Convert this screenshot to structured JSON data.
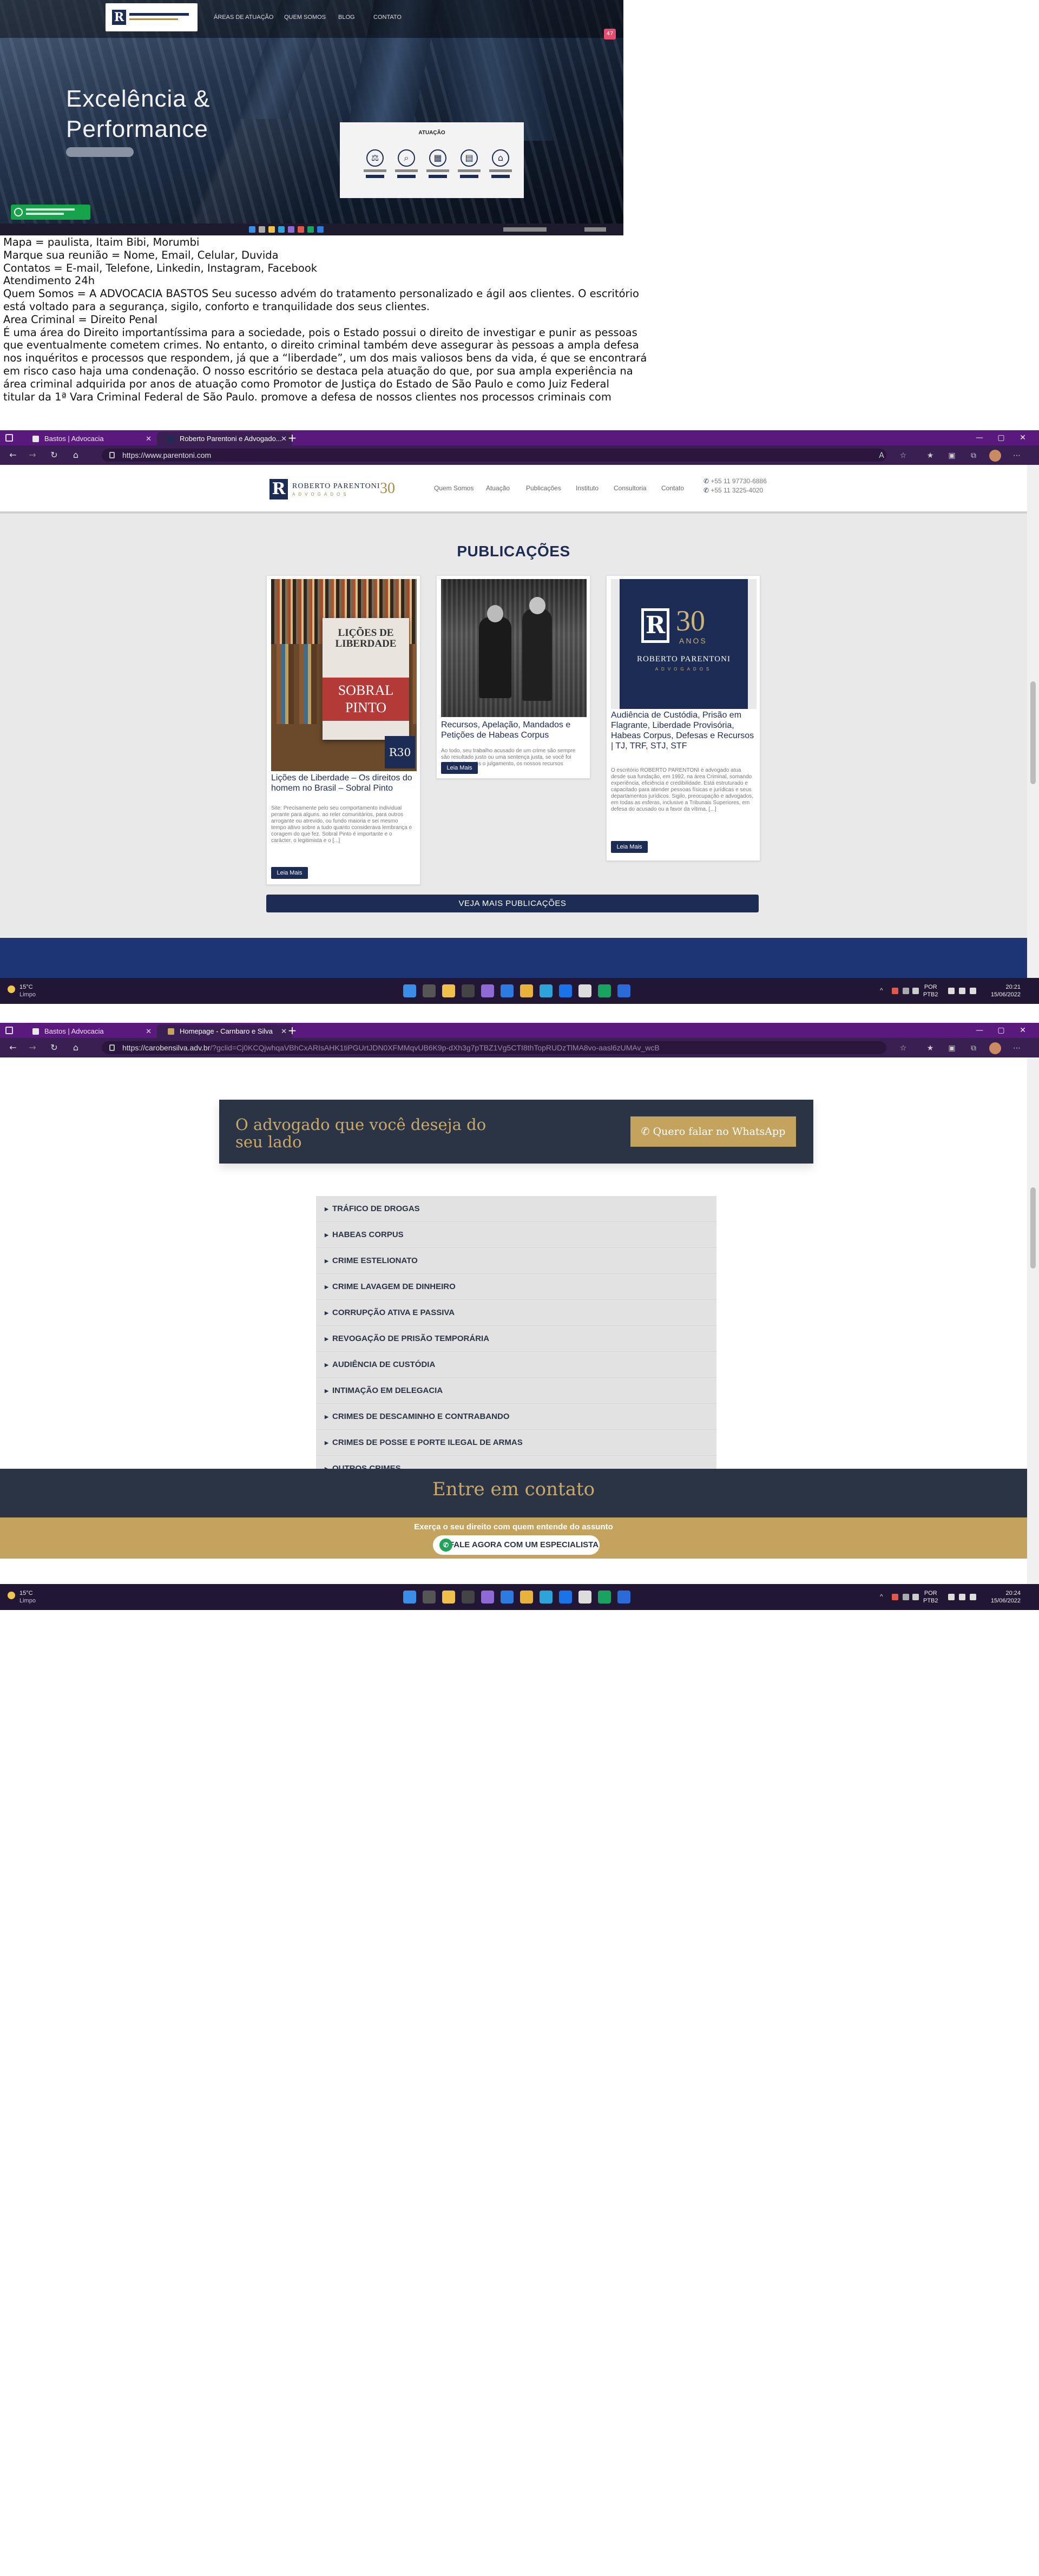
{
  "landing": {
    "nav": [
      "ÁREAS DE ATUAÇÃO",
      "QUEM SOMOS",
      "BLOG",
      "CONTATO"
    ],
    "hero_line1": "Excelência &",
    "hero_line2": "Performance",
    "atuacao_title": "ATUAÇÃO",
    "badge": "47"
  },
  "notes": [
    "Mapa = paulista, Itaim Bibi, Morumbi",
    "Marque sua reunião = Nome, Email, Celular, Duvida",
    "Contatos = E-mail, Telefone, Linkedin, Instagram, Facebook",
    "Atendimento 24h",
    "Quem Somos = A ADVOCACIA BASTOS Seu sucesso advém do tratamento personalizado e ágil aos clientes. O escritório",
    "está voltado para a segurança, sigilo, conforto e tranquilidade dos seus clientes.",
    "Area Criminal = Direito Penal",
    "É uma área do Direito importantíssima para a sociedade, pois o Estado possui o direito de investigar e punir as pessoas",
    "que eventualmente cometem crimes. No entanto, o direito criminal também deve assegurar às pessoas a ampla defesa",
    "nos inquéritos e processos que respondem, já que a “liberdade”, um dos mais valiosos bens da vida, é que se encontrará",
    "em risco caso haja uma condenação. O nosso escritório se destaca pela atuação do que, por sua ampla experiência na",
    "área criminal adquirida por anos de atuação como Promotor de Justiça do Estado de São Paulo e como Juiz Federal",
    "titular da 1ª Vara Criminal Federal de São Paulo. promove a defesa de nossos clientes nos processos criminais com"
  ],
  "window1": {
    "tabs": [
      "Bastos | Advocacia",
      "Roberto Parentoni e Advogado..."
    ],
    "url": "https://www.parentoni.com",
    "logo_name": "ROBERTO PARENTONI",
    "logo_sub": "ADVOGADOS",
    "logo_years": "30",
    "menu": [
      "Quem Somos",
      "Atuação",
      "Publicações",
      "Instituto",
      "Consultoria",
      "Contato"
    ],
    "phone1": "+55 11 97730-6886",
    "phone2": "+55 11 3225-4020",
    "section_title": "PUBLICAÇÕES",
    "cards": [
      {
        "title": "Lições de Liberdade – Os direitos do homem no Brasil – Sobral Pinto",
        "excerpt": "Site: Precisamente pelo seu comportamento individual perante para alguns. ao reler comunitários, para outros arrogante ou atrevido, ou fundo maioria e sei mesmo tempo altivo sobre a tudo quanto considerava lembrança e coragem do que fez. Sobral Pinto é importante e o carácter, o legitimista e o [...]",
        "read_more": "Leia Mais",
        "book_line1": "LIÇÕES DE",
        "book_line2": "LIBERDADE",
        "book_name": "SOBRAL PINTO"
      },
      {
        "title": "Recursos, Apelação, Mandados e Petições de Habeas Corpus",
        "excerpt": "Ao todo, seu trabalho acusado de um crime são sempre são resultado justo ou uma sentença justa, se você foi condenado após o julgamento, os nossos recursos criminais, embora tenha sido no pior cenário seu histórico de vida, ainda há uma chance de obter um resultado melhor. Se o caso de tribunal [...]",
        "read_more": "Leia Mais"
      },
      {
        "title": "Audiência de Custódia, Prisão em Flagrante, Liberdade Provisória, Habeas Corpus, Defesas e Recursos | TJ, TRF, STJ, STF",
        "excerpt": "O escritório ROBERTO PARENTONI é advogado atua desde sua fundação, em 1992, na área Criminal, somando experiência, eficiência e credibilidade. Está estruturado e capacitado para atender pessoas físicas e jurídicas e seus departamentos jurídicos. Sigilo, preocupação e advogados, em todas as esferas, inclusive a Tribunais Superiores, em defesa do acusado ou a favor da vítima. [...]",
        "read_more": "Leia Mais",
        "logo_anos": "ANOS",
        "logo_name": "ROBERTO PARENTONI",
        "logo_sub": "ADVOGADOS"
      }
    ],
    "more_button": "VEJA MAIS PUBLICAÇÕES",
    "taskbar": {
      "temp": "15°C",
      "cond": "Limpo",
      "lang1": "POR",
      "lang2": "PTB2",
      "time": "20:21",
      "date": "15/06/2022"
    }
  },
  "window2": {
    "tabs": [
      "Bastos | Advocacia",
      "Homepage - Carnbaro e Silva"
    ],
    "url_host": "https://carobensilva.adv.br",
    "url_rest": "/?gclid=Cj0KCQjwhqaVBhCxARIsAHK1tiPGUrtJDN0XFMMqvUB6K9p-dXh3g7pTBZ1Vg5CTI8thTopRUDzTlMA8vo-aasl6zUMAv_wcB",
    "cta_text": "O advogado que você deseja do seu lado",
    "cta_button": "Quero falar no WhatsApp",
    "accordion": [
      "TRÁFICO DE DROGAS",
      "HABEAS CORPUS",
      "CRIME ESTELIONATO",
      "CRIME LAVAGEM DE DINHEIRO",
      "CORRUPÇÃO ATIVA E PASSIVA",
      "REVOGAÇÃO DE PRISÃO TEMPORÁRIA",
      "AUDIÊNCIA DE CUSTÓDIA",
      "INTIMAÇÃO EM DELEGACIA",
      "CRIMES DE DESCAMINHO E CONTRABANDO",
      "CRIMES DE POSSE E PORTE ILEGAL DE ARMAS",
      "OUTROS CRIMES"
    ],
    "contact_title": "Entre em contato",
    "contact_sub": "Exerça o seu direito com quem entende do assunto",
    "contact_button": "FALE AGORA COM UM ESPECIALISTA",
    "taskbar": {
      "temp": "15°C",
      "cond": "Limpo",
      "lang1": "POR",
      "lang2": "PTB2",
      "time": "20:24",
      "date": "15/06/2022"
    }
  },
  "colors": {
    "navy": "#1d2c55",
    "gold": "#c4a35e",
    "browser_purple": "#5a1a7d",
    "dark_slate": "#2b3444"
  }
}
